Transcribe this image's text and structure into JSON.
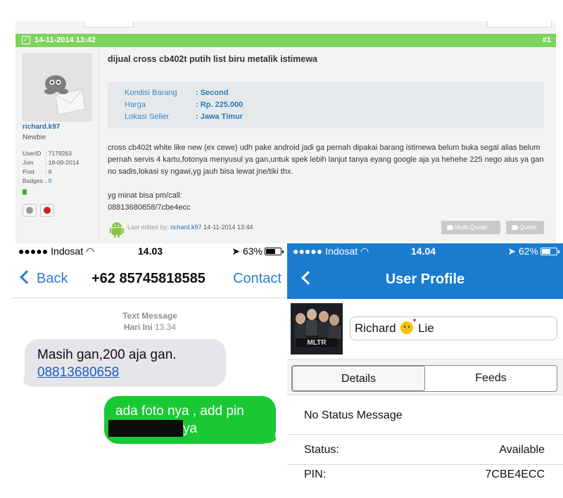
{
  "forum": {
    "post_date": "14-11-2014 13:42",
    "post_number": "#1",
    "user": {
      "name": "richard.k97",
      "rank": "Newbie",
      "stats": [
        {
          "key": "UserID",
          "value": ": 7179263"
        },
        {
          "key": "Join",
          "value": ": 18-09-2014"
        },
        {
          "key": "Post",
          "value": ": 8"
        },
        {
          "key": "Badges",
          "value": ": 0"
        }
      ]
    },
    "title": "dijual cross cb402t putih list biru metalik istimewa",
    "info": [
      {
        "key": "Kondisi Barang",
        "value": ": Second"
      },
      {
        "key": "Harga",
        "value": ": Rp. 225.000"
      },
      {
        "key": "Lokasi Seller",
        "value": ": Jawa Timur"
      }
    ],
    "body": [
      "cross cb402t white like new (ex cewe) udh pake android jadi ga pernah dipakai barang istimewa belum buka segal alias belum pernah servis 4 kartu,fotonya menyusul ya gan,untuk spek lebih lanjut tanya eyang google aja ya hehehe 225 nego alus ya gan no sadis,lokasi sy ngawi,yg jauh bisa lewat jne/tiki thx.",
      "yg minat bisa pm/call:\n08813680658/7cbe4ecc"
    ],
    "edit": {
      "prefix": "Last edited by: ",
      "user": "richard.k97",
      "time": "14-11-2014 13:44"
    },
    "buttons": {
      "multi_quote": "Multi Quote",
      "quote": "Quote"
    },
    "colors": {
      "bar": "#7ed35e",
      "link": "#2a6db0"
    }
  },
  "sms": {
    "status": {
      "carrier": "●●●●● Indosat",
      "time": "14.03",
      "battery": "63%",
      "battery_level": 0.63
    },
    "back_label": "Back",
    "title": "+62 85745818585",
    "contact_label": "Contact",
    "meta_type": "Text Message",
    "meta_day": "Hari Ini",
    "meta_time": "13.34",
    "incoming": {
      "text": "Masih gan,200 aja gan.",
      "link": "08813680658"
    },
    "outgoing": {
      "line1": "ada foto nya , add pin",
      "line2": "ya"
    },
    "colors": {
      "accent": "#2e7ad6",
      "incoming": "#e5e5ea",
      "outgoing": "#19c934"
    }
  },
  "profile": {
    "status": {
      "carrier": "●●●●● Indosat",
      "time": "14.04",
      "battery": "62%",
      "battery_level": 0.62
    },
    "title": "User Profile",
    "photo_text": "MLTR",
    "name_first": "Richard",
    "name_last": "Lie",
    "tabs": [
      "Details",
      "Feeds"
    ],
    "status_message": "No Status Message",
    "status_label": "Status:",
    "status_value": "Available",
    "pin_label": "PIN:",
    "pin_value": "7CBE4ECC",
    "colors": {
      "header": "#1b7ccf"
    }
  }
}
